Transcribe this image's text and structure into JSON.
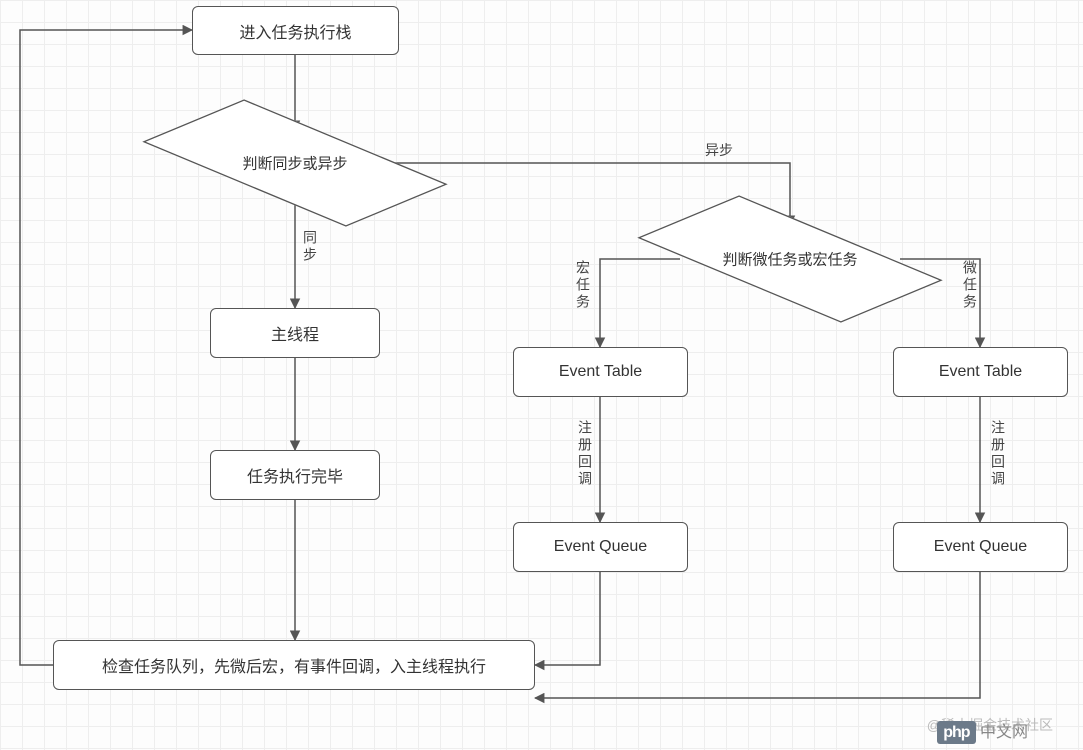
{
  "nodes": {
    "enter_stack": "进入任务执行栈",
    "decide_sync": "判断同步或异步",
    "main_thread": "主线程",
    "task_done": "任务执行完毕",
    "check_queue": "检查任务队列，先微后宏，有事件回调，入主线程执行",
    "decide_task_type": "判断微任务或宏任务",
    "event_table_macro": "Event Table",
    "event_queue_macro": "Event Queue",
    "event_table_micro": "Event Table",
    "event_queue_micro": "Event Queue"
  },
  "edges": {
    "sync": "同步",
    "async": "异步",
    "macro": "宏任务",
    "micro": "微任务",
    "register_cb_1": "注册回调",
    "register_cb_2": "注册回调"
  },
  "watermark": "@稀土掘金技术社区",
  "logo_text": "中文网",
  "logo_brand": "php"
}
